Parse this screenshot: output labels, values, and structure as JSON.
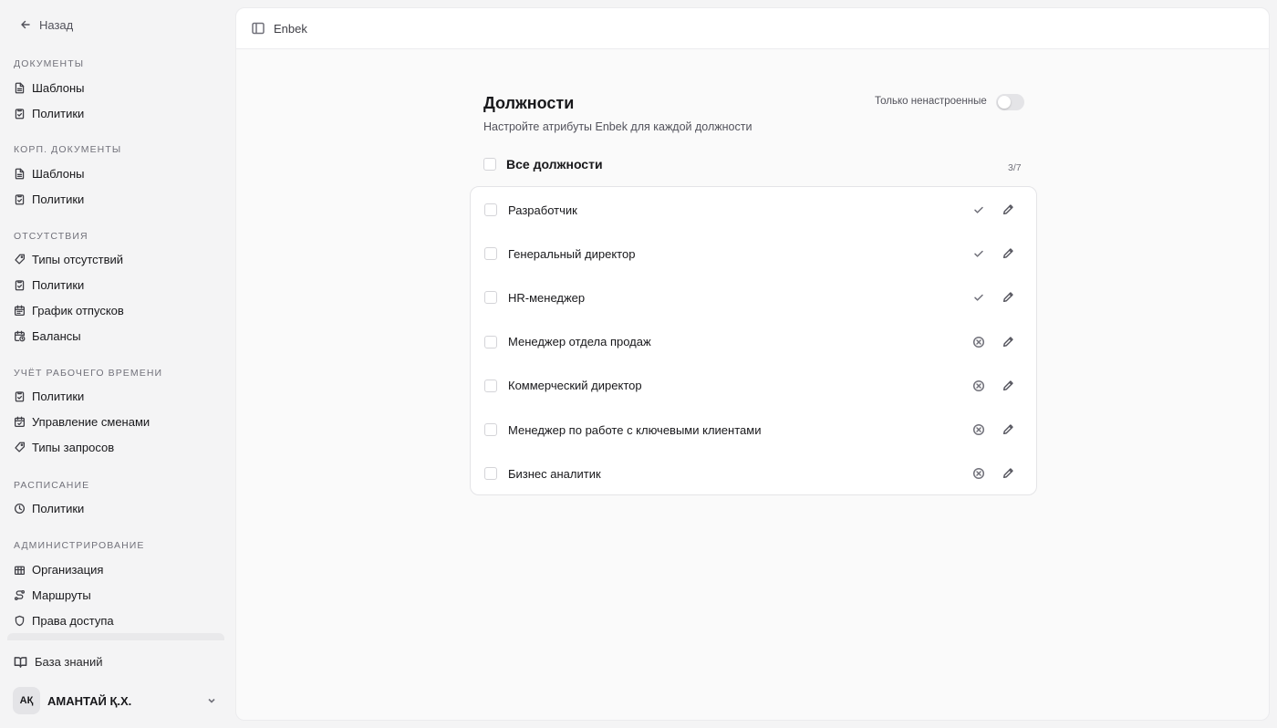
{
  "sidebar": {
    "back_label": "Назад",
    "sections": [
      {
        "title": "Документы",
        "items": [
          {
            "label": "Шаблоны",
            "icon": "file-icon"
          },
          {
            "label": "Политики",
            "icon": "clipboard-check-icon"
          }
        ]
      },
      {
        "title": "Корп. документы",
        "items": [
          {
            "label": "Шаблоны",
            "icon": "file-icon"
          },
          {
            "label": "Политики",
            "icon": "clipboard-check-icon"
          }
        ]
      },
      {
        "title": "Отсутствия",
        "items": [
          {
            "label": "Типы отсутствий",
            "icon": "tag-icon"
          },
          {
            "label": "Политики",
            "icon": "clipboard-check-icon"
          },
          {
            "label": "График отпусков",
            "icon": "calendar-icon"
          },
          {
            "label": "Балансы",
            "icon": "calendar-clock-icon"
          }
        ]
      },
      {
        "title": "Учёт рабочего времени",
        "items": [
          {
            "label": "Политики",
            "icon": "clipboard-check-icon"
          },
          {
            "label": "Управление сменами",
            "icon": "calendar-check-icon"
          },
          {
            "label": "Типы запросов",
            "icon": "tag-icon"
          }
        ]
      },
      {
        "title": "Расписание",
        "items": [
          {
            "label": "Политики",
            "icon": "clock-icon"
          }
        ]
      },
      {
        "title": "Администрирование",
        "items": [
          {
            "label": "Организация",
            "icon": "building-icon"
          },
          {
            "label": "Маршруты",
            "icon": "route-icon"
          },
          {
            "label": "Права доступа",
            "icon": "shield-icon"
          }
        ]
      }
    ],
    "knowledge_base": "База знаний",
    "user": {
      "initials": "AҚ",
      "name": "АМАНТАЙ Қ.Х."
    }
  },
  "topbar": {
    "breadcrumb": "Enbek"
  },
  "page": {
    "title": "Должности",
    "subtitle": "Настройте атрибуты Enbek для каждой должности",
    "filter_label": "Только ненастроенные",
    "filter_on": false,
    "all_label": "Все должности",
    "counter": "3/7"
  },
  "positions": [
    {
      "name": "Разработчик",
      "status": "configured"
    },
    {
      "name": "Генеральный директор",
      "status": "configured"
    },
    {
      "name": "HR-менеджер",
      "status": "configured"
    },
    {
      "name": "Менеджер отдела продаж",
      "status": "not-configured"
    },
    {
      "name": "Коммерческий директор",
      "status": "not-configured"
    },
    {
      "name": "Менеджер по работе с ключевыми клиентами",
      "status": "not-configured"
    },
    {
      "name": "Бизнес аналитик",
      "status": "not-configured"
    }
  ],
  "colors": {
    "accent_text": "#18181b",
    "muted_text": "#71717a",
    "panel_bg": "#fafafa",
    "sidebar_bg": "#f4f4f5"
  }
}
